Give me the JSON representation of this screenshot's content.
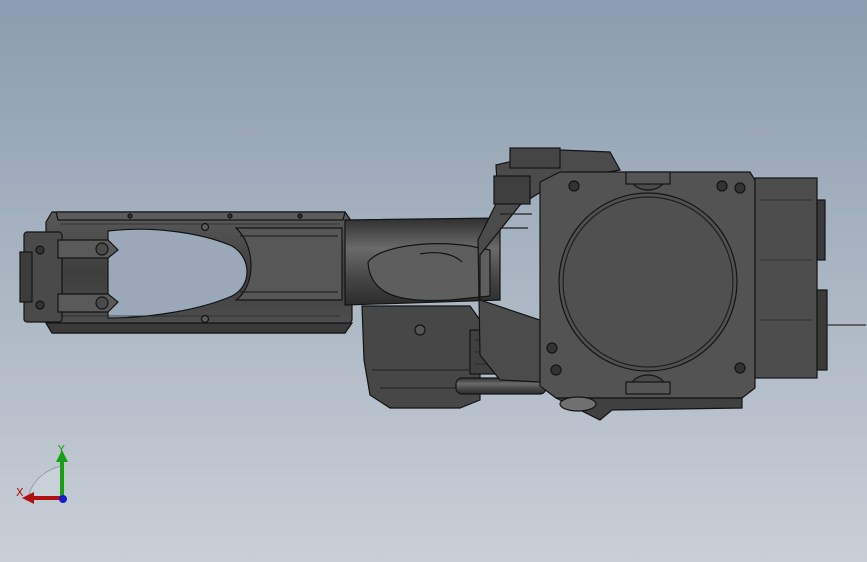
{
  "viewport": {
    "background_top": "#8b9db0",
    "background_bottom": "#c9cfd6"
  },
  "model": {
    "body_color": "#4a4a4a",
    "edge_color": "#141414",
    "highlight_color": "#6a6a6a"
  },
  "triad": {
    "x_label": "X",
    "y_label": "Y",
    "x_color": "#b01010",
    "y_color": "#17a017",
    "z_color": "#1a1ac8"
  }
}
